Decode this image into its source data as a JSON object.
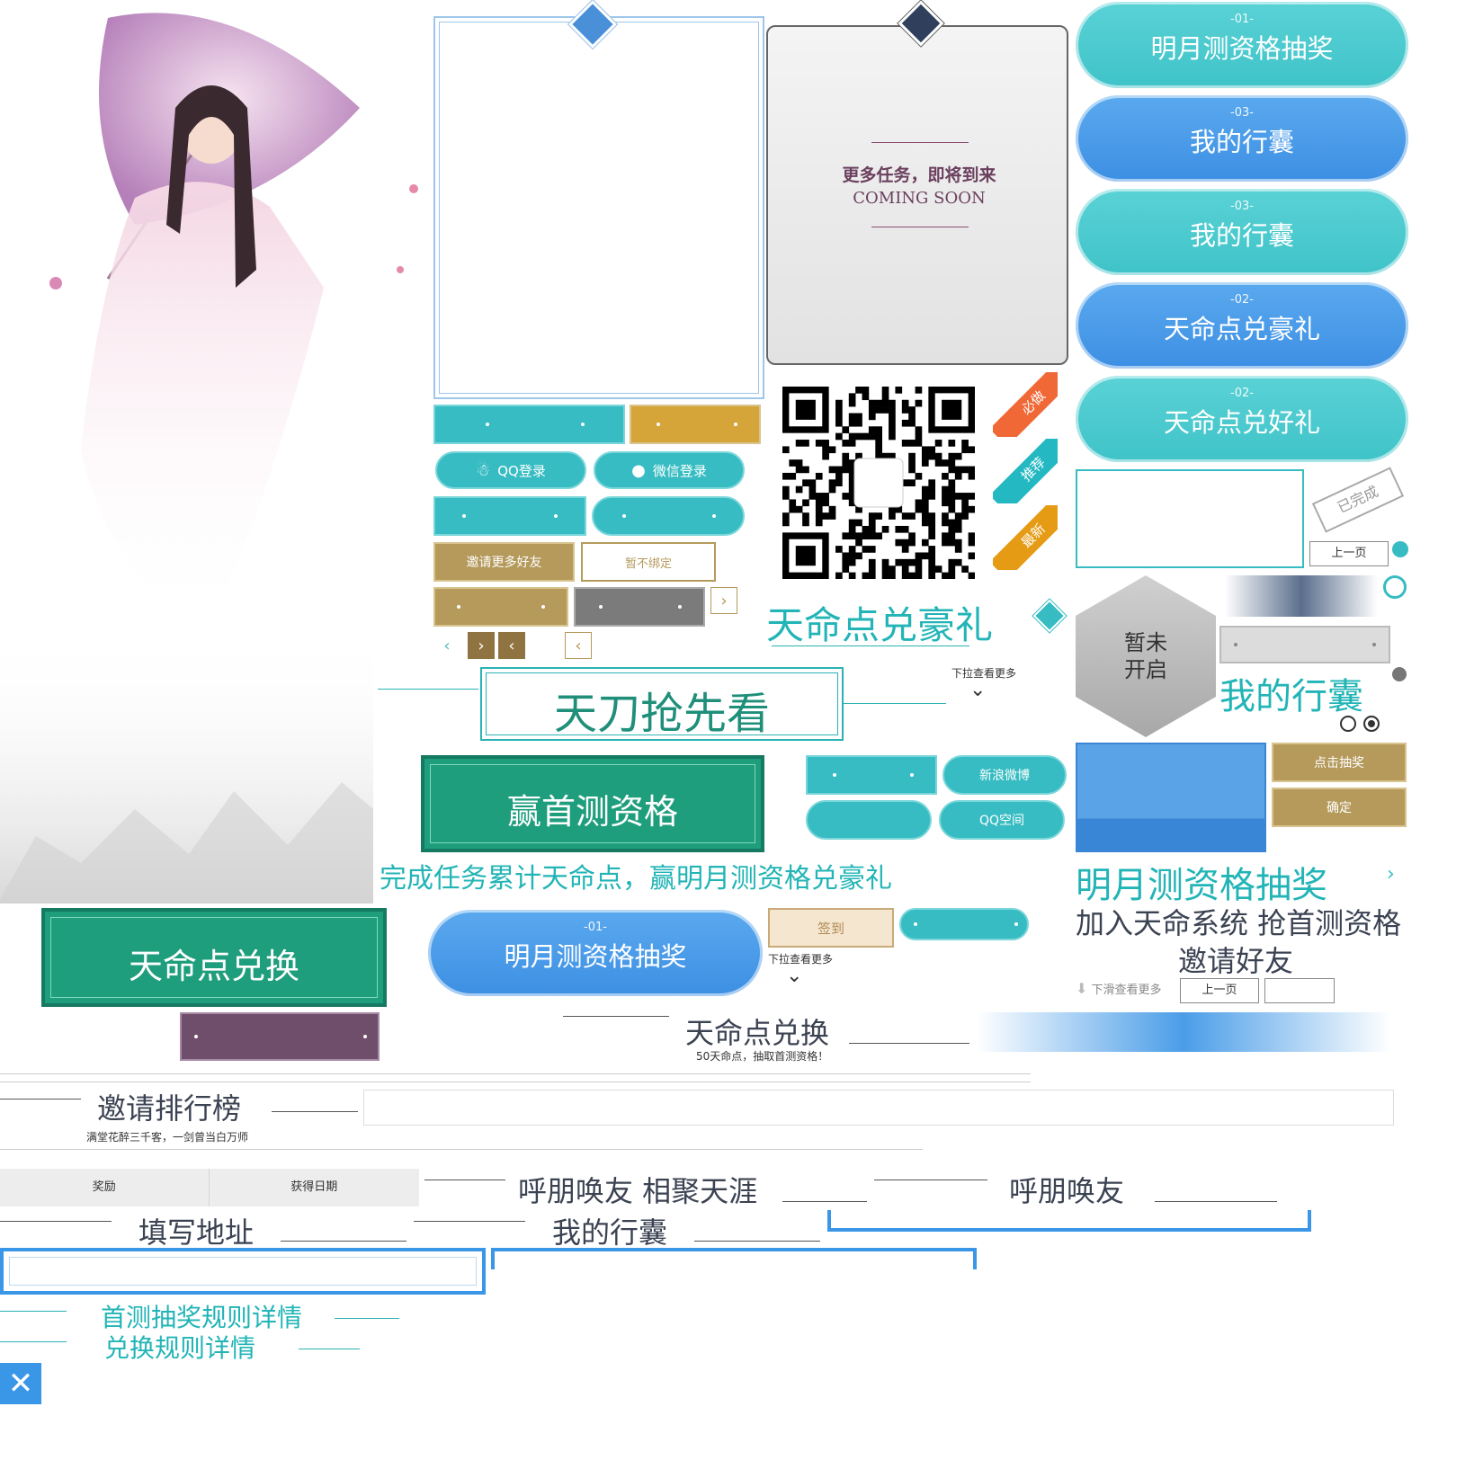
{
  "colors": {
    "teal": "#36bcc2",
    "gold": "#b59a5c",
    "blue": "#4a9de8",
    "green": "#1e9e7c",
    "purple": "#6f4e6b",
    "dark_text": "#3b4252"
  },
  "coming_soon": {
    "title": "更多任务，即将到来",
    "subtitle": "COMING SOON"
  },
  "login": {
    "qq": "QQ登录",
    "wechat": "微信登录"
  },
  "buttons": {
    "invite_more": "邀请更多好友",
    "no_bind": "暂不绑定",
    "sign_in": "签到",
    "weibo": "新浪微博",
    "qzone": "QQ空间",
    "click_draw": "点击抽奖",
    "confirm": "确定",
    "prev_page": "上一页",
    "prev_page_2": "上一页"
  },
  "ribbons": {
    "must_do": "必做",
    "recommend": "推荐",
    "newest": "最新"
  },
  "tabs": [
    {
      "num": "-01-",
      "label": "明月测资格抽奖",
      "color": "teal"
    },
    {
      "num": "-03-",
      "label": "我的行囊",
      "color": "blue"
    },
    {
      "num": "-03-",
      "label": "我的行囊",
      "color": "teal"
    },
    {
      "num": "-02-",
      "label": "天命点兑豪礼",
      "color": "blue"
    },
    {
      "num": "-02-",
      "label": "天命点兑好礼",
      "color": "teal"
    }
  ],
  "tab_mid": {
    "num": "-01-",
    "label": "明月测资格抽奖"
  },
  "headings": {
    "tiandian_gift": "天命点兑豪礼",
    "tiandao_preview": "天刀抢先看",
    "win_qualification": "赢首测资格",
    "complete_tasks": "完成任务累计天命点，赢明月测资格兑豪礼",
    "tianming_exchange": "天命点兑换",
    "my_bag": "我的行囊",
    "moon_draw": "明月测资格抽奖",
    "join_system": "加入天命系统 抢首测资格",
    "invite_friends": "邀请好友",
    "tianming_exchange_2": "天命点兑换",
    "exchange_sub": "50天命点，抽取首测资格！",
    "invite_rank": "邀请排行榜",
    "invite_rank_sub": "满堂花醉三千客，一剑曾当白万师",
    "call_friends_gather": "呼朋唤友 相聚天涯",
    "call_friends": "呼朋唤友",
    "fill_address": "填写地址",
    "my_bag_2": "我的行囊",
    "draw_rules": "首测抽奖规则详情",
    "exchange_rules": "兑换规则详情"
  },
  "pull_more": {
    "down_1": "下拉查看更多",
    "down_2": "下拉查看更多",
    "slide": "下滑查看更多"
  },
  "not_open": "暂未\n开启",
  "stamp": "已完成",
  "table": {
    "col_reward": "奖励",
    "col_date": "获得日期"
  }
}
